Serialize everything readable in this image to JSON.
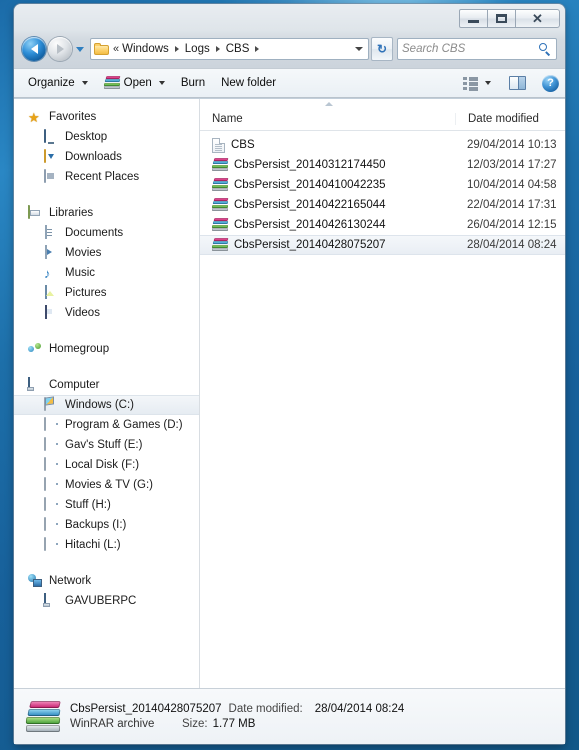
{
  "window": {
    "caption_buttons": {
      "minimize": "–",
      "maximize": "□",
      "close": "✕"
    }
  },
  "address_bar": {
    "back_tooltip": "Back",
    "forward_tooltip": "Forward",
    "overflow": "«",
    "crumbs": [
      "Windows",
      "Logs",
      "CBS"
    ],
    "dropdown": "▼",
    "refresh": "↻"
  },
  "search": {
    "placeholder": "Search CBS"
  },
  "toolbar": {
    "organize": "Organize",
    "open": "Open",
    "burn": "Burn",
    "new_folder": "New folder",
    "help": "?"
  },
  "sidebar": {
    "groups": [
      {
        "header": "Favorites",
        "icon": "star-icon",
        "items": [
          {
            "label": "Desktop",
            "icon": "desktop-icon"
          },
          {
            "label": "Downloads",
            "icon": "downloads-icon"
          },
          {
            "label": "Recent Places",
            "icon": "recent-places-icon"
          }
        ]
      },
      {
        "header": "Libraries",
        "icon": "libraries-icon",
        "items": [
          {
            "label": "Documents",
            "icon": "documents-icon"
          },
          {
            "label": "Movies",
            "icon": "movies-icon"
          },
          {
            "label": "Music",
            "icon": "music-icon"
          },
          {
            "label": "Pictures",
            "icon": "pictures-icon"
          },
          {
            "label": "Videos",
            "icon": "videos-icon"
          }
        ]
      },
      {
        "header": "Homegroup",
        "icon": "homegroup-icon",
        "items": []
      },
      {
        "header": "Computer",
        "icon": "computer-icon",
        "items": [
          {
            "label": "Windows (C:)",
            "icon": "windows-drive-icon",
            "selected": true
          },
          {
            "label": "Program & Games (D:)",
            "icon": "drive-icon"
          },
          {
            "label": "Gav's Stuff (E:)",
            "icon": "drive-icon"
          },
          {
            "label": "Local Disk (F:)",
            "icon": "drive-icon"
          },
          {
            "label": "Movies & TV (G:)",
            "icon": "drive-icon"
          },
          {
            "label": "Stuff (H:)",
            "icon": "drive-icon"
          },
          {
            "label": "Backups (I:)",
            "icon": "drive-icon"
          },
          {
            "label": "Hitachi (L:)",
            "icon": "drive-icon"
          }
        ]
      },
      {
        "header": "Network",
        "icon": "network-icon",
        "items": [
          {
            "label": "GAVUBERPC",
            "icon": "network-computer-icon"
          }
        ]
      }
    ]
  },
  "file_list": {
    "columns": [
      "Name",
      "Date modified"
    ],
    "rows": [
      {
        "name": "CBS",
        "date": "29/04/2014 10:13",
        "icon": "text-file-icon",
        "selected": false
      },
      {
        "name": "CbsPersist_20140312174450",
        "date": "12/03/2014 17:27",
        "icon": "winrar-archive-icon",
        "selected": false
      },
      {
        "name": "CbsPersist_20140410042235",
        "date": "10/04/2014 04:58",
        "icon": "winrar-archive-icon",
        "selected": false
      },
      {
        "name": "CbsPersist_20140422165044",
        "date": "22/04/2014 17:31",
        "icon": "winrar-archive-icon",
        "selected": false
      },
      {
        "name": "CbsPersist_20140426130244",
        "date": "26/04/2014 12:15",
        "icon": "winrar-archive-icon",
        "selected": false
      },
      {
        "name": "CbsPersist_20140428075207",
        "date": "28/04/2014 08:24",
        "icon": "winrar-archive-icon",
        "selected": true
      }
    ]
  },
  "details_pane": {
    "file_name": "CbsPersist_20140428075207",
    "date_modified_label": "Date modified:",
    "date_modified_value": "28/04/2014 08:24",
    "file_type": "WinRAR archive",
    "size_label": "Size:",
    "size_value": "1.77 MB"
  }
}
